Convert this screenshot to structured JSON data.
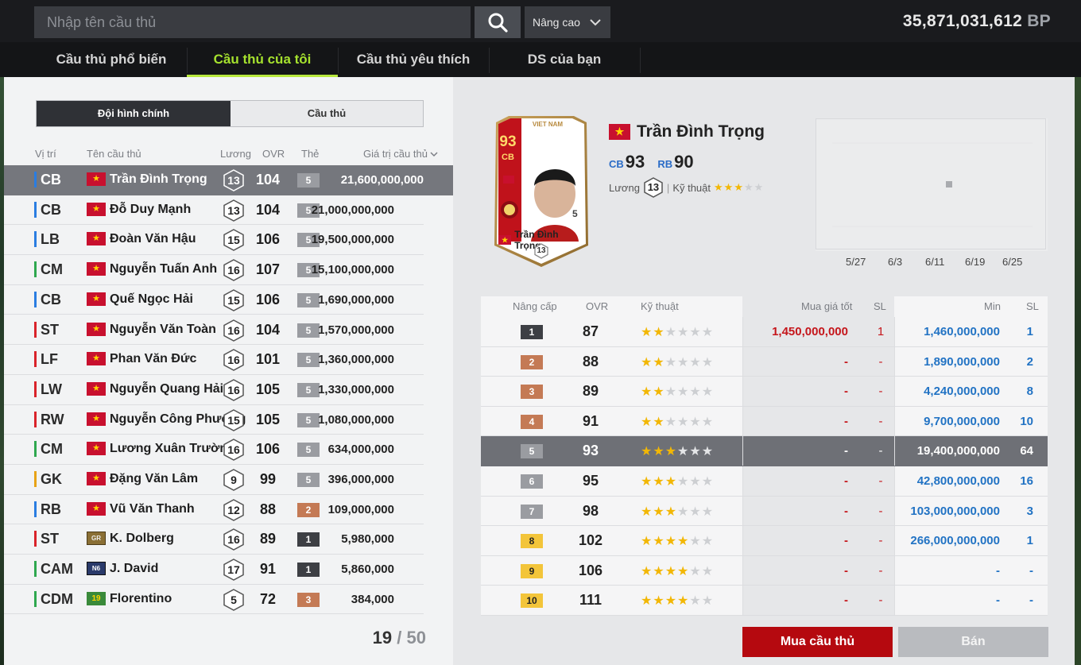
{
  "search": {
    "placeholder": "Nhập tên cầu thủ"
  },
  "advanced": {
    "label": "Nâng cao"
  },
  "balance": {
    "value": "35,871,031,612",
    "unit": "BP"
  },
  "tabs": [
    "Cầu thủ phổ biến",
    "Cầu thủ của tôi",
    "Cầu thủ yêu thích",
    "DS của bạn"
  ],
  "active_tab": "Cầu thủ của tôi",
  "toggle": {
    "squad": "Đội hình chính",
    "players": "Cầu thủ"
  },
  "list_headers": {
    "pos": "Vị trí",
    "name": "Tên cầu thủ",
    "salary": "Lương",
    "ovr": "OVR",
    "card": "Thẻ",
    "value": "Giá trị cầu thủ"
  },
  "players": [
    {
      "pos": "CB",
      "flag": "★",
      "name": "Trần Đình Trọng",
      "salary": "13",
      "ovr": "104",
      "card": "5",
      "value": "21,600,000,000",
      "pos_color": "#2a7de1"
    },
    {
      "pos": "CB",
      "flag": "★",
      "name": "Đỗ Duy Mạnh",
      "salary": "13",
      "ovr": "104",
      "card": "5",
      "value": "21,000,000,000",
      "pos_color": "#2a7de1"
    },
    {
      "pos": "LB",
      "flag": "★",
      "name": "Đoàn Văn Hậu",
      "salary": "15",
      "ovr": "106",
      "card": "5",
      "value": "19,500,000,000",
      "pos_color": "#2a7de1"
    },
    {
      "pos": "CM",
      "flag": "★",
      "name": "Nguyễn Tuấn Anh",
      "salary": "16",
      "ovr": "107",
      "card": "5",
      "value": "15,100,000,000",
      "pos_color": "#2fa84f"
    },
    {
      "pos": "CB",
      "flag": "★",
      "name": "Quế Ngọc Hải",
      "salary": "15",
      "ovr": "106",
      "card": "5",
      "value": "1,690,000,000",
      "pos_color": "#2a7de1"
    },
    {
      "pos": "ST",
      "flag": "★",
      "name": "Nguyễn Văn Toàn",
      "salary": "16",
      "ovr": "104",
      "card": "5",
      "value": "1,570,000,000",
      "pos_color": "#d9232a"
    },
    {
      "pos": "LF",
      "flag": "★",
      "name": "Phan Văn Đức",
      "salary": "16",
      "ovr": "101",
      "card": "5",
      "value": "1,360,000,000",
      "pos_color": "#d9232a"
    },
    {
      "pos": "LW",
      "flag": "★",
      "name": "Nguyễn Quang Hải",
      "salary": "16",
      "ovr": "105",
      "card": "5",
      "value": "1,330,000,000",
      "pos_color": "#d9232a"
    },
    {
      "pos": "RW",
      "flag": "★",
      "name": "Nguyễn Công Phượng",
      "salary": "15",
      "ovr": "105",
      "card": "5",
      "value": "1,080,000,000",
      "pos_color": "#d9232a"
    },
    {
      "pos": "CM",
      "flag": "★",
      "name": "Lương Xuân Trường",
      "salary": "16",
      "ovr": "106",
      "card": "5",
      "value": "634,000,000",
      "pos_color": "#2fa84f"
    },
    {
      "pos": "GK",
      "flag": "★",
      "name": "Đặng Văn Lâm",
      "salary": "9",
      "ovr": "99",
      "card": "5",
      "value": "396,000,000",
      "pos_color": "#e8a317"
    },
    {
      "pos": "RB",
      "flag": "★",
      "name": "Vũ Văn Thanh",
      "salary": "12",
      "ovr": "88",
      "card": "2",
      "value": "109,000,000",
      "pos_color": "#2a7de1"
    },
    {
      "pos": "ST",
      "flag": "GR",
      "name": "K. Dolberg",
      "salary": "16",
      "ovr": "89",
      "card": "1",
      "value": "5,980,000",
      "pos_color": "#d9232a"
    },
    {
      "pos": "CAM",
      "flag": "N6",
      "name": "J. David",
      "salary": "17",
      "ovr": "91",
      "card": "1",
      "value": "5,860,000",
      "pos_color": "#2fa84f"
    },
    {
      "pos": "CDM",
      "flag": "19",
      "name": "Florentino",
      "salary": "5",
      "ovr": "72",
      "card": "3",
      "value": "384,000",
      "pos_color": "#2fa84f"
    }
  ],
  "pager": {
    "current": "19",
    "sep": "/",
    "total": "50"
  },
  "detail": {
    "card_nation": "VIET NAM",
    "card_ovr": "93",
    "card_pos": "CB",
    "card_level": "5",
    "card_salary": "13",
    "name": "Trần Đình Trọng",
    "pos1": "CB",
    "ovr1": "93",
    "pos2": "RB",
    "ovr2": "90",
    "salary_label": "Lương",
    "salary": "13",
    "skill_label": "Kỹ thuật",
    "skill_stars": 3
  },
  "price_chart": {
    "x_labels": [
      "5/27",
      "6/3",
      "6/11",
      "6/19",
      "6/25"
    ]
  },
  "upgrade_headers": {
    "level": "Nâng cấp",
    "ovr": "OVR",
    "skill": "Kỹ thuật",
    "best": "Mua giá tốt",
    "sl": "SL",
    "min": "Min",
    "sl2": "SL"
  },
  "upgrades": [
    {
      "level": "1",
      "ovr": "87",
      "stars": 2,
      "best": "1,450,000,000",
      "sl": "1",
      "min": "1,460,000,000",
      "sl2": "1"
    },
    {
      "level": "2",
      "ovr": "88",
      "stars": 2,
      "best": "-",
      "sl": "-",
      "min": "1,890,000,000",
      "sl2": "2"
    },
    {
      "level": "3",
      "ovr": "89",
      "stars": 2,
      "best": "-",
      "sl": "-",
      "min": "4,240,000,000",
      "sl2": "8"
    },
    {
      "level": "4",
      "ovr": "91",
      "stars": 2,
      "best": "-",
      "sl": "-",
      "min": "9,700,000,000",
      "sl2": "10"
    },
    {
      "level": "5",
      "ovr": "93",
      "stars": 3,
      "best": "-",
      "sl": "-",
      "min": "19,400,000,000",
      "sl2": "64"
    },
    {
      "level": "6",
      "ovr": "95",
      "stars": 3,
      "best": "-",
      "sl": "-",
      "min": "42,800,000,000",
      "sl2": "16"
    },
    {
      "level": "7",
      "ovr": "98",
      "stars": 3,
      "best": "-",
      "sl": "-",
      "min": "103,000,000,000",
      "sl2": "3"
    },
    {
      "level": "8",
      "ovr": "102",
      "stars": 4,
      "best": "-",
      "sl": "-",
      "min": "266,000,000,000",
      "sl2": "1"
    },
    {
      "level": "9",
      "ovr": "106",
      "stars": 4,
      "best": "-",
      "sl": "-",
      "min": "-",
      "sl2": "-"
    },
    {
      "level": "10",
      "ovr": "111",
      "stars": 4,
      "best": "-",
      "sl": "-",
      "min": "-",
      "sl2": "-"
    }
  ],
  "buttons": {
    "buy": "Mua cầu thủ",
    "sell": "Bán"
  },
  "colors": {
    "accent_green": "#b8e83c",
    "buy_red": "#b5090f",
    "price_blue": "#2273c4",
    "best_red": "#c5161b"
  }
}
